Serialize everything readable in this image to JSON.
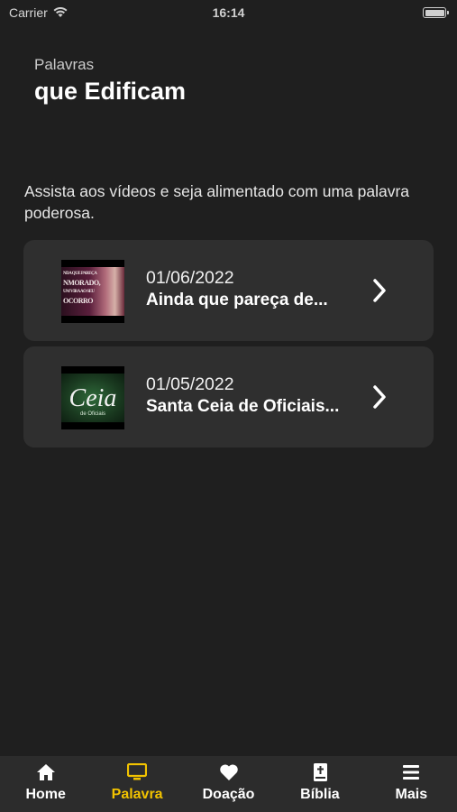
{
  "status_bar": {
    "carrier": "Carrier",
    "time": "16:14"
  },
  "header": {
    "small": "Palavras",
    "big": "que Edificam"
  },
  "intro": "Assista aos vídeos e seja alimentado com uma palavra poderosa.",
  "videos": [
    {
      "date": "01/06/2022",
      "title": "Ainda que pareça de...",
      "thumb_text": [
        "NDA QUE PAREÇA",
        "NMORADO,",
        "UM VIRA AO SEU",
        "OCORRO"
      ]
    },
    {
      "date": "01/05/2022",
      "title": "Santa Ceia de Oficiais...",
      "thumb_text": [
        "Ceia",
        "de Oficiais"
      ]
    }
  ],
  "tabbar": {
    "tabs": [
      {
        "label": "Home",
        "icon": "home-icon"
      },
      {
        "label": "Palavra",
        "icon": "monitor-icon",
        "active": true
      },
      {
        "label": "Doação",
        "icon": "heart-icon"
      },
      {
        "label": "Bíblia",
        "icon": "bible-icon"
      },
      {
        "label": "Mais",
        "icon": "menu-icon"
      }
    ],
    "active_color": "#f2c300"
  },
  "colors": {
    "background": "#1f1f1f",
    "card": "#2f2f2f",
    "tabbar": "#2c2c2c"
  }
}
